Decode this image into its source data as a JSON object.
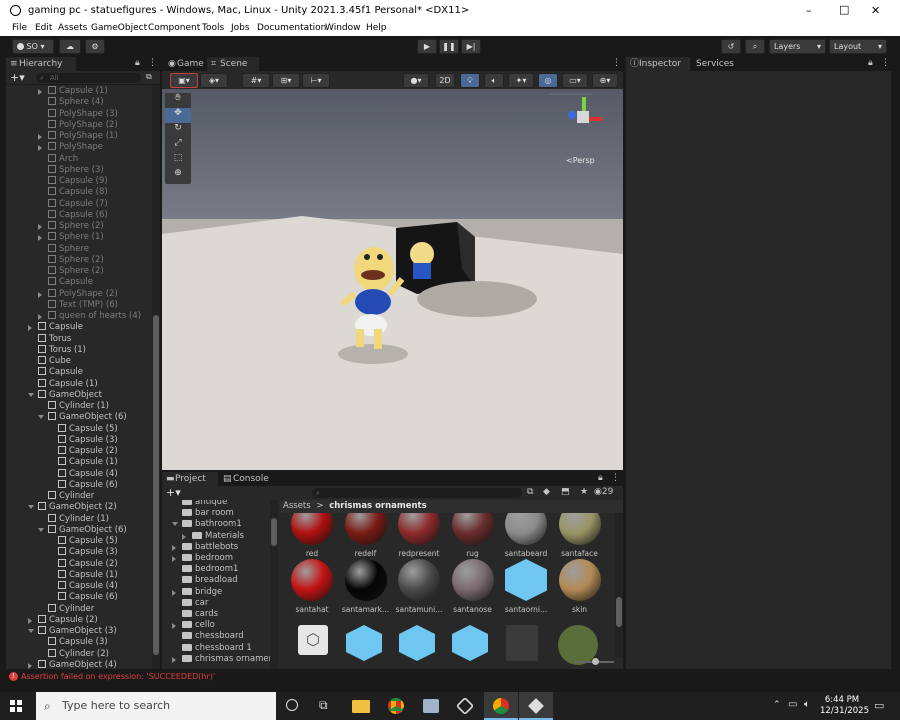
{
  "window": {
    "title": "gaming pc - statuefigures - Windows, Mac, Linux - Unity 2021.3.45f1 Personal* <DX11>",
    "controls": [
      "–",
      "□",
      "✕"
    ]
  },
  "menu": [
    "File",
    "Edit",
    "Assets",
    "GameObject",
    "Component",
    "Tools",
    "Jobs",
    "Documentation",
    "Window",
    "Help"
  ],
  "toolbar": {
    "account": "SO",
    "layers": "Layers",
    "layout": "Layout"
  },
  "hierarchy": {
    "tab": "Hierarchy",
    "search_placeholder": "All",
    "rows": [
      {
        "label": "Capsule (1)",
        "d": 1,
        "dim": true,
        "arr": "r"
      },
      {
        "label": "Sphere (4)",
        "d": 1,
        "dim": true
      },
      {
        "label": "PolyShape (3)",
        "d": 1,
        "dim": true
      },
      {
        "label": "PolyShape (2)",
        "d": 1,
        "dim": true
      },
      {
        "label": "PolyShape (1)",
        "d": 1,
        "dim": true,
        "arr": "r"
      },
      {
        "label": "PolyShape",
        "d": 1,
        "dim": true,
        "arr": "r"
      },
      {
        "label": "Arch",
        "d": 1,
        "dim": true
      },
      {
        "label": "Sphere (3)",
        "d": 1,
        "dim": true
      },
      {
        "label": "Capsule (9)",
        "d": 1,
        "dim": true
      },
      {
        "label": "Capsule (8)",
        "d": 1,
        "dim": true
      },
      {
        "label": "Capsule (7)",
        "d": 1,
        "dim": true
      },
      {
        "label": "Capsule (6)",
        "d": 1,
        "dim": true
      },
      {
        "label": "Sphere (2)",
        "d": 1,
        "dim": true,
        "arr": "r"
      },
      {
        "label": "Sphere (1)",
        "d": 1,
        "dim": true,
        "arr": "r"
      },
      {
        "label": "Sphere",
        "d": 1,
        "dim": true
      },
      {
        "label": "Sphere (2)",
        "d": 1,
        "dim": true
      },
      {
        "label": "Sphere (2)",
        "d": 1,
        "dim": true
      },
      {
        "label": "Capsule",
        "d": 1,
        "dim": true
      },
      {
        "label": "PolyShape (2)",
        "d": 1,
        "dim": true,
        "arr": "r"
      },
      {
        "label": "Text (TMP) (6)",
        "d": 1,
        "dim": true
      },
      {
        "label": "queen of hearts (4)",
        "d": 1,
        "dim": true,
        "arr": "r"
      },
      {
        "label": "Capsule",
        "d": 0,
        "arr": "r"
      },
      {
        "label": "Torus",
        "d": 0
      },
      {
        "label": "Torus (1)",
        "d": 0
      },
      {
        "label": "Cube",
        "d": 0
      },
      {
        "label": "Capsule",
        "d": 0
      },
      {
        "label": "Capsule (1)",
        "d": 0
      },
      {
        "label": "GameObject",
        "d": 0,
        "arr": "d"
      },
      {
        "label": "Cylinder (1)",
        "d": 1
      },
      {
        "label": "GameObject (6)",
        "d": 1,
        "arr": "d"
      },
      {
        "label": "Capsule (5)",
        "d": 2
      },
      {
        "label": "Capsule (3)",
        "d": 2
      },
      {
        "label": "Capsule (2)",
        "d": 2
      },
      {
        "label": "Capsule (1)",
        "d": 2
      },
      {
        "label": "Capsule (4)",
        "d": 2
      },
      {
        "label": "Capsule (6)",
        "d": 2
      },
      {
        "label": "Cylinder",
        "d": 1
      },
      {
        "label": "GameObject (2)",
        "d": 0,
        "arr": "d"
      },
      {
        "label": "Cylinder (1)",
        "d": 1
      },
      {
        "label": "GameObject (6)",
        "d": 1,
        "arr": "d"
      },
      {
        "label": "Capsule (5)",
        "d": 2
      },
      {
        "label": "Capsule (3)",
        "d": 2
      },
      {
        "label": "Capsule (2)",
        "d": 2
      },
      {
        "label": "Capsule (1)",
        "d": 2
      },
      {
        "label": "Capsule (4)",
        "d": 2
      },
      {
        "label": "Capsule (6)",
        "d": 2
      },
      {
        "label": "Cylinder",
        "d": 1
      },
      {
        "label": "Capsule (2)",
        "d": 0,
        "arr": "r"
      },
      {
        "label": "GameObject (3)",
        "d": 0,
        "arr": "d"
      },
      {
        "label": "Capsule (3)",
        "d": 1
      },
      {
        "label": "Cylinder (2)",
        "d": 1
      },
      {
        "label": "GameObject (4)",
        "d": 0,
        "arr": "r"
      }
    ]
  },
  "view_tabs": {
    "game": "Game",
    "scene": "Scene"
  },
  "scene": {
    "mode_2d": "2D",
    "persp": "<Persp"
  },
  "inspector": {
    "tab": "Inspector",
    "services": "Services"
  },
  "project": {
    "tab": "Project",
    "console": "Console",
    "badge": "29",
    "breadcrumb_root": "Assets",
    "breadcrumb_sep": ">",
    "breadcrumb_current": "chrismas ornaments",
    "folders": [
      {
        "label": "antique",
        "d": 1
      },
      {
        "label": "bar room",
        "d": 1
      },
      {
        "label": "bathroom1",
        "d": 1,
        "arr": "d"
      },
      {
        "label": "Materials",
        "d": 2,
        "arr": "r"
      },
      {
        "label": "battlebots",
        "d": 1,
        "arr": "r"
      },
      {
        "label": "bedroom",
        "d": 1,
        "arr": "r"
      },
      {
        "label": "bedroom1",
        "d": 1
      },
      {
        "label": "breadload",
        "d": 1
      },
      {
        "label": "bridge",
        "d": 1,
        "arr": "r"
      },
      {
        "label": "car",
        "d": 1
      },
      {
        "label": "cards",
        "d": 1
      },
      {
        "label": "cello",
        "d": 1,
        "arr": "r"
      },
      {
        "label": "chessboard",
        "d": 1
      },
      {
        "label": "chessboard 1",
        "d": 1
      },
      {
        "label": "chrismas ornament",
        "d": 1,
        "arr": "r"
      }
    ],
    "assets_row1": [
      {
        "label": "red",
        "c": "#b01010"
      },
      {
        "label": "redelf",
        "c": "#7a1a14"
      },
      {
        "label": "redpresent",
        "c": "#8d2a2a"
      },
      {
        "label": "rug",
        "c": "#6b2c2c"
      },
      {
        "label": "santabeard",
        "c": "#8c8c8c"
      },
      {
        "label": "santaface",
        "c": "#9a9566"
      }
    ],
    "assets_row2": [
      {
        "label": "santahat",
        "c": "#c41212"
      },
      {
        "label": "santamark...",
        "c": "#050505"
      },
      {
        "label": "santamuni...",
        "c": "#4a4a4a"
      },
      {
        "label": "santanose",
        "c": "#7a6a70"
      },
      {
        "label": "santaorni...",
        "c": "#6dc7f0"
      },
      {
        "label": "skin",
        "c": "#b38a55"
      }
    ]
  },
  "console_error": "Assertion failed on expression: 'SUCCEEDED(hr)'",
  "taskbar": {
    "search_placeholder": "Type here to search",
    "time": "6:44 PM",
    "date": "12/31/2025"
  }
}
